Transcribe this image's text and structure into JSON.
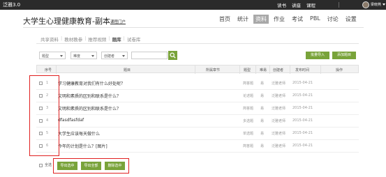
{
  "topbar": {
    "brand": "泛雅3.0",
    "links": [
      "读书",
      "讲座",
      "课程"
    ],
    "username": "梁晓燕"
  },
  "course": {
    "title": "大学生心理健康教育-副本",
    "portal_link": "课程门户"
  },
  "mainnav": {
    "items": [
      "首页",
      "统计",
      "资料",
      "作业",
      "考试",
      "PBL",
      "讨论",
      "设置"
    ],
    "active": "资料"
  },
  "subtabs": {
    "items": [
      "共享资料",
      "教材教参",
      "推荐视频",
      "题库",
      "试卷库"
    ],
    "active": "题库"
  },
  "filters": {
    "type_select": "题型",
    "difficulty_select": "难度",
    "creator_select": "创建者",
    "search_placeholder": ""
  },
  "actions": {
    "batch_import": "批量导入",
    "add_question": "添加题目"
  },
  "table": {
    "headers": [
      "序号",
      "题目",
      "所属章节",
      "题型",
      "难易",
      "创建者",
      "发布时间",
      "操作"
    ],
    "rows": [
      {
        "num": "1",
        "title": "学习健康教育对我们有什么好处呢？",
        "chapter": "",
        "type": "简答题",
        "difficulty": "易",
        "creator": "泛雅老师",
        "date": "2015-04-21"
      },
      {
        "num": "2",
        "title": "文明和素质的区别和联系是什么？",
        "chapter": "",
        "type": "论述题",
        "difficulty": "易",
        "creator": "泛雅老师",
        "date": "2015-04-21"
      },
      {
        "num": "3",
        "title": "文明和素质的区别和联系是什么？",
        "chapter": "",
        "type": "简答题",
        "difficulty": "易",
        "creator": "泛雅老师",
        "date": "2015-04-21"
      },
      {
        "num": "4",
        "title": "dfasdfasfdaf",
        "chapter": "",
        "type": "多选题",
        "difficulty": "易",
        "creator": "泛雅老师",
        "date": "2015-04-21"
      },
      {
        "num": "5",
        "title": "大学生应该每天做什么",
        "chapter": "",
        "type": "单选题",
        "difficulty": "易",
        "creator": "泛雅老师",
        "date": "2015-04-21"
      },
      {
        "num": "6",
        "title": "今年的计划是什么？[图片]",
        "chapter": "",
        "type": "简答题",
        "difficulty": "易",
        "creator": "泛雅老师",
        "date": "2015-04-21"
      }
    ]
  },
  "bottom": {
    "select_all": "全选",
    "export_selected": "导出选中",
    "export_all": "导出全部",
    "delete_selected": "删除选中"
  },
  "colors": {
    "accent_green": "#79a33a",
    "topbar_bg": "#2b2b2b",
    "highlight_red": "#e02020"
  }
}
